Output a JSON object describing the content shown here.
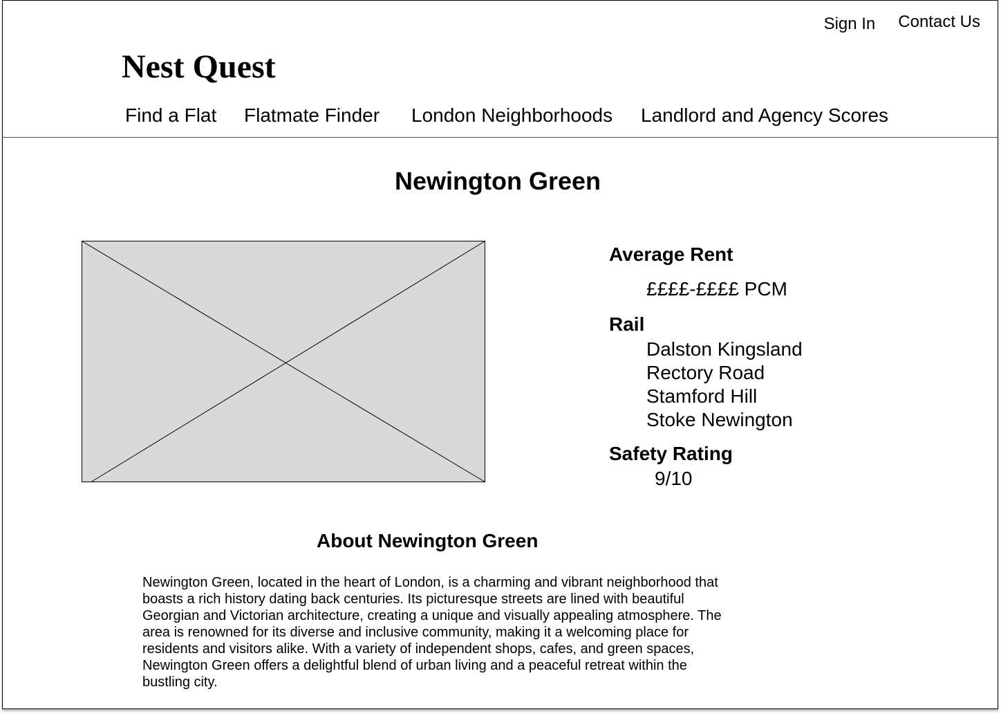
{
  "header": {
    "sign_in": "Sign In",
    "contact_us": "Contact Us",
    "logo": "Nest Quest"
  },
  "nav": {
    "items": [
      {
        "label": "Find a Flat"
      },
      {
        "label": "Flatmate Finder"
      },
      {
        "label": "London Neighborhoods"
      },
      {
        "label": "Landlord and Agency Scores"
      }
    ]
  },
  "page": {
    "title": "Newington Green"
  },
  "image": {
    "icon": "image-placeholder-icon",
    "fill": "#d9d9d9"
  },
  "info": {
    "rent_heading": "Average Rent",
    "rent_value": "££££-££££ PCM",
    "rail_heading": "Rail",
    "rail_stations": [
      "Dalston Kingsland",
      "Rectory Road",
      "Stamford Hill",
      "Stoke Newington"
    ],
    "safety_heading": "Safety Rating",
    "safety_value": "9/10"
  },
  "about": {
    "title": "About Newington Green",
    "text": "Newington Green, located in the heart of London, is a charming and vibrant neighborhood that boasts a rich history dating back centuries. Its picturesque streets are lined with beautiful Georgian and Victorian architecture, creating a unique and visually appealing atmosphere. The area is renowned for its diverse and inclusive community, making it a welcoming place for residents and visitors alike. With a variety of independent shops, cafes, and green spaces, Newington Green offers a delightful blend of urban living and a peaceful retreat within the bustling city."
  }
}
